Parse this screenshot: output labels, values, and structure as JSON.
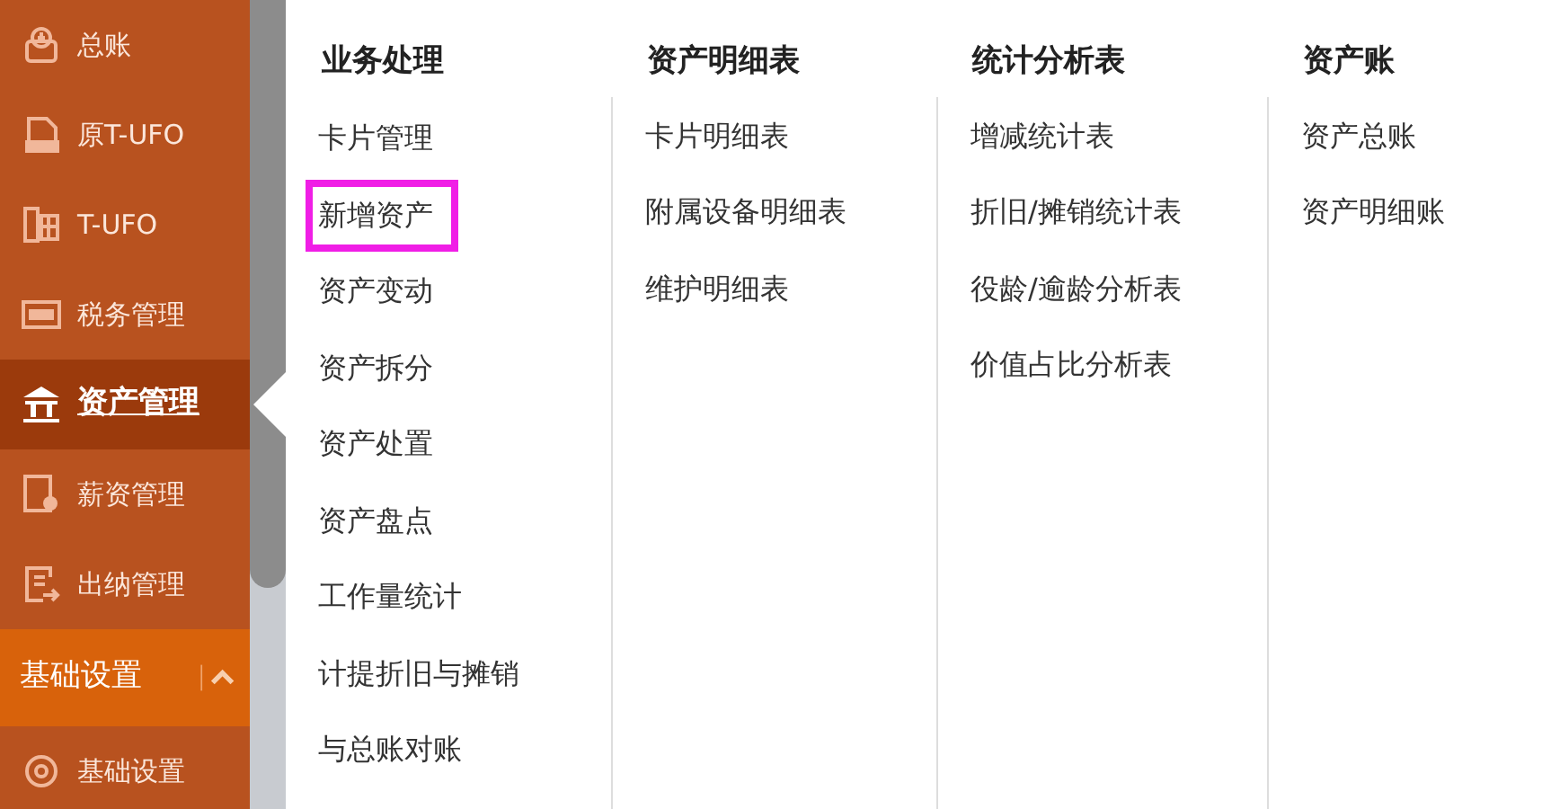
{
  "sidebar": {
    "items": [
      {
        "label": "总账",
        "selected": false,
        "kind": "item"
      },
      {
        "label": "原T-UFO",
        "selected": false,
        "kind": "item"
      },
      {
        "label": "T-UFO",
        "selected": false,
        "kind": "item"
      },
      {
        "label": "税务管理",
        "selected": false,
        "kind": "item"
      },
      {
        "label": "资产管理",
        "selected": true,
        "kind": "item"
      },
      {
        "label": "薪资管理",
        "selected": false,
        "kind": "item"
      },
      {
        "label": "出纳管理",
        "selected": false,
        "kind": "item"
      },
      {
        "label": "基础设置",
        "kind": "section",
        "expanded": true
      },
      {
        "label": "基础设置",
        "selected": false,
        "kind": "item"
      }
    ]
  },
  "menu": {
    "columns": [
      {
        "heading": "业务处理",
        "items": [
          {
            "label": "卡片管理",
            "highlighted": false
          },
          {
            "label": "新增资产",
            "highlighted": true
          },
          {
            "label": "资产变动",
            "highlighted": false
          },
          {
            "label": "资产拆分",
            "highlighted": false
          },
          {
            "label": "资产处置",
            "highlighted": false
          },
          {
            "label": "资产盘点",
            "highlighted": false
          },
          {
            "label": "工作量统计",
            "highlighted": false
          },
          {
            "label": "计提折旧与摊销",
            "highlighted": false
          },
          {
            "label": "与总账对账",
            "highlighted": false
          }
        ]
      },
      {
        "heading": "资产明细表",
        "items": [
          {
            "label": "卡片明细表",
            "highlighted": false
          },
          {
            "label": "附属设备明细表",
            "highlighted": false
          },
          {
            "label": "维护明细表",
            "highlighted": false
          }
        ]
      },
      {
        "heading": "统计分析表",
        "items": [
          {
            "label": "增减统计表",
            "highlighted": false
          },
          {
            "label": "折旧/摊销统计表",
            "highlighted": false
          },
          {
            "label": "役龄/逾龄分析表",
            "highlighted": false
          },
          {
            "label": "价值占比分析表",
            "highlighted": false
          }
        ]
      },
      {
        "heading": "资产账",
        "items": [
          {
            "label": "资产总账",
            "highlighted": false
          },
          {
            "label": "资产明细账",
            "highlighted": false
          }
        ]
      }
    ]
  }
}
